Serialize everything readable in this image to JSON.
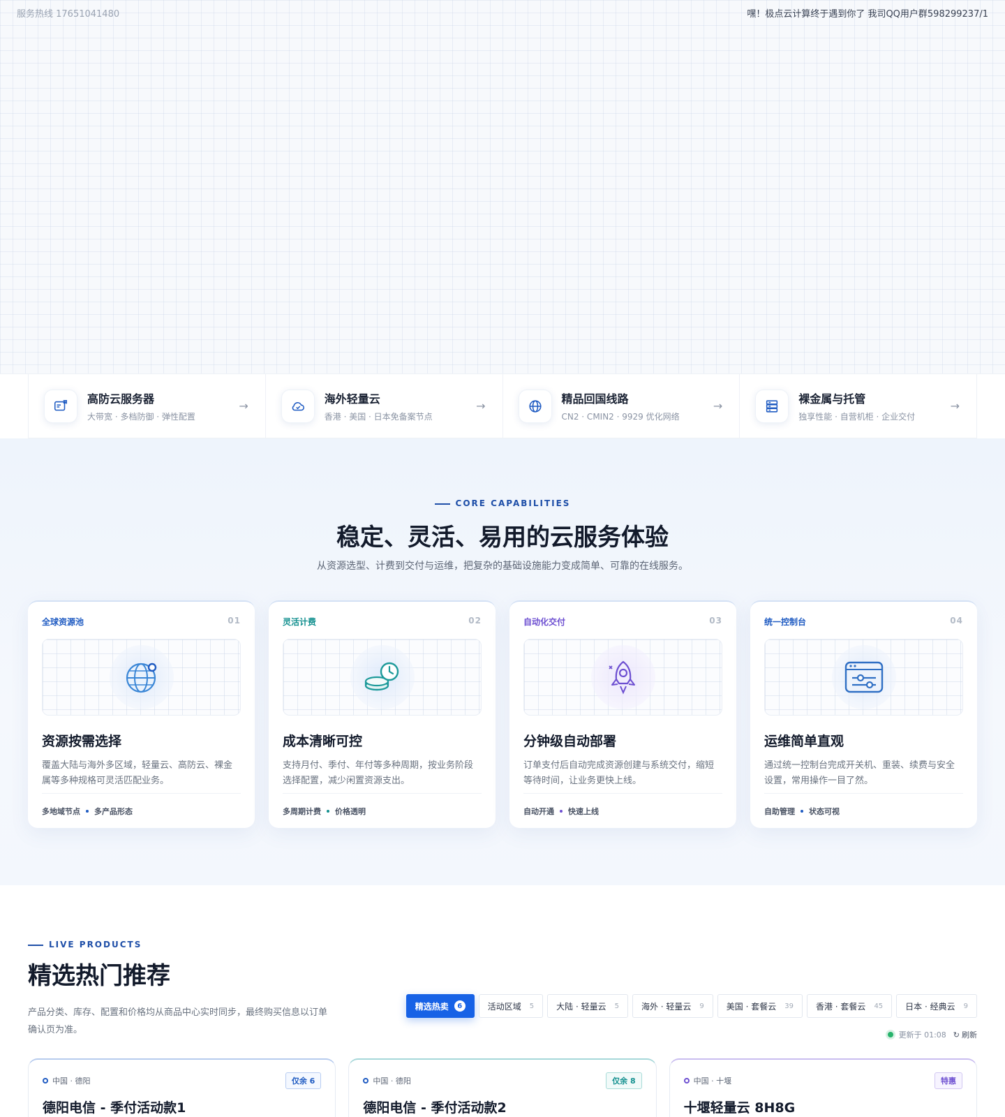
{
  "topbar": {
    "hotline": "服务热线 17651041480",
    "notice": "嘿！极点云计算终于遇到你了 我司QQ用户群598299237/1"
  },
  "quick_links": [
    {
      "title": "高防云服务器",
      "sub": "大带宽 · 多档防御 · 弹性配置",
      "icon": "server-shield-icon"
    },
    {
      "title": "海外轻量云",
      "sub": "香港 · 美国 · 日本免备案节点",
      "icon": "cloud-check-icon"
    },
    {
      "title": "精品回国线路",
      "sub": "CN2 · CMIN2 · 9929 优化网络",
      "icon": "globe-icon"
    },
    {
      "title": "裸金属与托管",
      "sub": "独享性能 · 自营机柜 · 企业交付",
      "icon": "server-rack-icon"
    }
  ],
  "capabilities": {
    "eyebrow": "CORE CAPABILITIES",
    "title": "稳定、灵活、易用的云服务体验",
    "subtitle": "从资源选型、计费到交付与运维，把复杂的基础设施能力变成简单、可靠的在线服务。",
    "cards": [
      {
        "tag": "全球资源池",
        "num": "01",
        "title": "资源按需选择",
        "desc": "覆盖大陆与海外多区域，轻量云、高防云、裸金属等多种规格可灵活匹配业务。",
        "foot_a": "多地域节点",
        "foot_b": "多产品形态",
        "icon": "globe-icon",
        "tag_color": "#1f5bc2"
      },
      {
        "tag": "灵活计费",
        "num": "02",
        "title": "成本清晰可控",
        "desc": "支持月付、季付、年付等多种周期，按业务阶段选择配置，减少闲置资源支出。",
        "foot_a": "多周期计费",
        "foot_b": "价格透明",
        "icon": "coins-clock-icon",
        "tag_color": "#13908f"
      },
      {
        "tag": "自动化交付",
        "num": "03",
        "title": "分钟级自动部署",
        "desc": "订单支付后自动完成资源创建与系统交付，缩短等待时间，让业务更快上线。",
        "foot_a": "自动开通",
        "foot_b": "快速上线",
        "icon": "rocket-icon",
        "tag_color": "#6d4fd1"
      },
      {
        "tag": "统一控制台",
        "num": "04",
        "title": "运维简单直观",
        "desc": "通过统一控制台完成开关机、重装、续费与安全设置，常用操作一目了然。",
        "foot_a": "自助管理",
        "foot_b": "状态可视",
        "icon": "dashboard-icon",
        "tag_color": "#1f5bc2"
      }
    ]
  },
  "live": {
    "eyebrow": "LIVE PRODUCTS",
    "title": "精选热门推荐",
    "subtitle": "产品分类、库存、配置和价格均从商品中心实时同步，最终购买信息以订单确认页为准。",
    "filters": [
      {
        "label": "精选热卖",
        "count": "6",
        "active": true
      },
      {
        "label": "活动区域",
        "count": "5"
      },
      {
        "label": "大陆 · 轻量云",
        "count": "5"
      },
      {
        "label": "海外 · 轻量云",
        "count": "9"
      },
      {
        "label": "美国 · 套餐云",
        "count": "39"
      },
      {
        "label": "香港 · 套餐云",
        "count": "45"
      },
      {
        "label": "日本 · 经典云",
        "count": "9"
      }
    ],
    "updated": "更新于 01:08",
    "refresh": "刷新",
    "products": [
      {
        "location": "中国 · 德阳",
        "badge": "仅余 6",
        "name": "德阳电信 - 季付活动款1"
      },
      {
        "location": "中国 · 德阳",
        "badge": "仅余 8",
        "name": "德阳电信 - 季付活动款2"
      },
      {
        "location": "中国 · 十堰",
        "badge": "特惠",
        "name": "十堰轻量云 8H8G"
      }
    ]
  }
}
